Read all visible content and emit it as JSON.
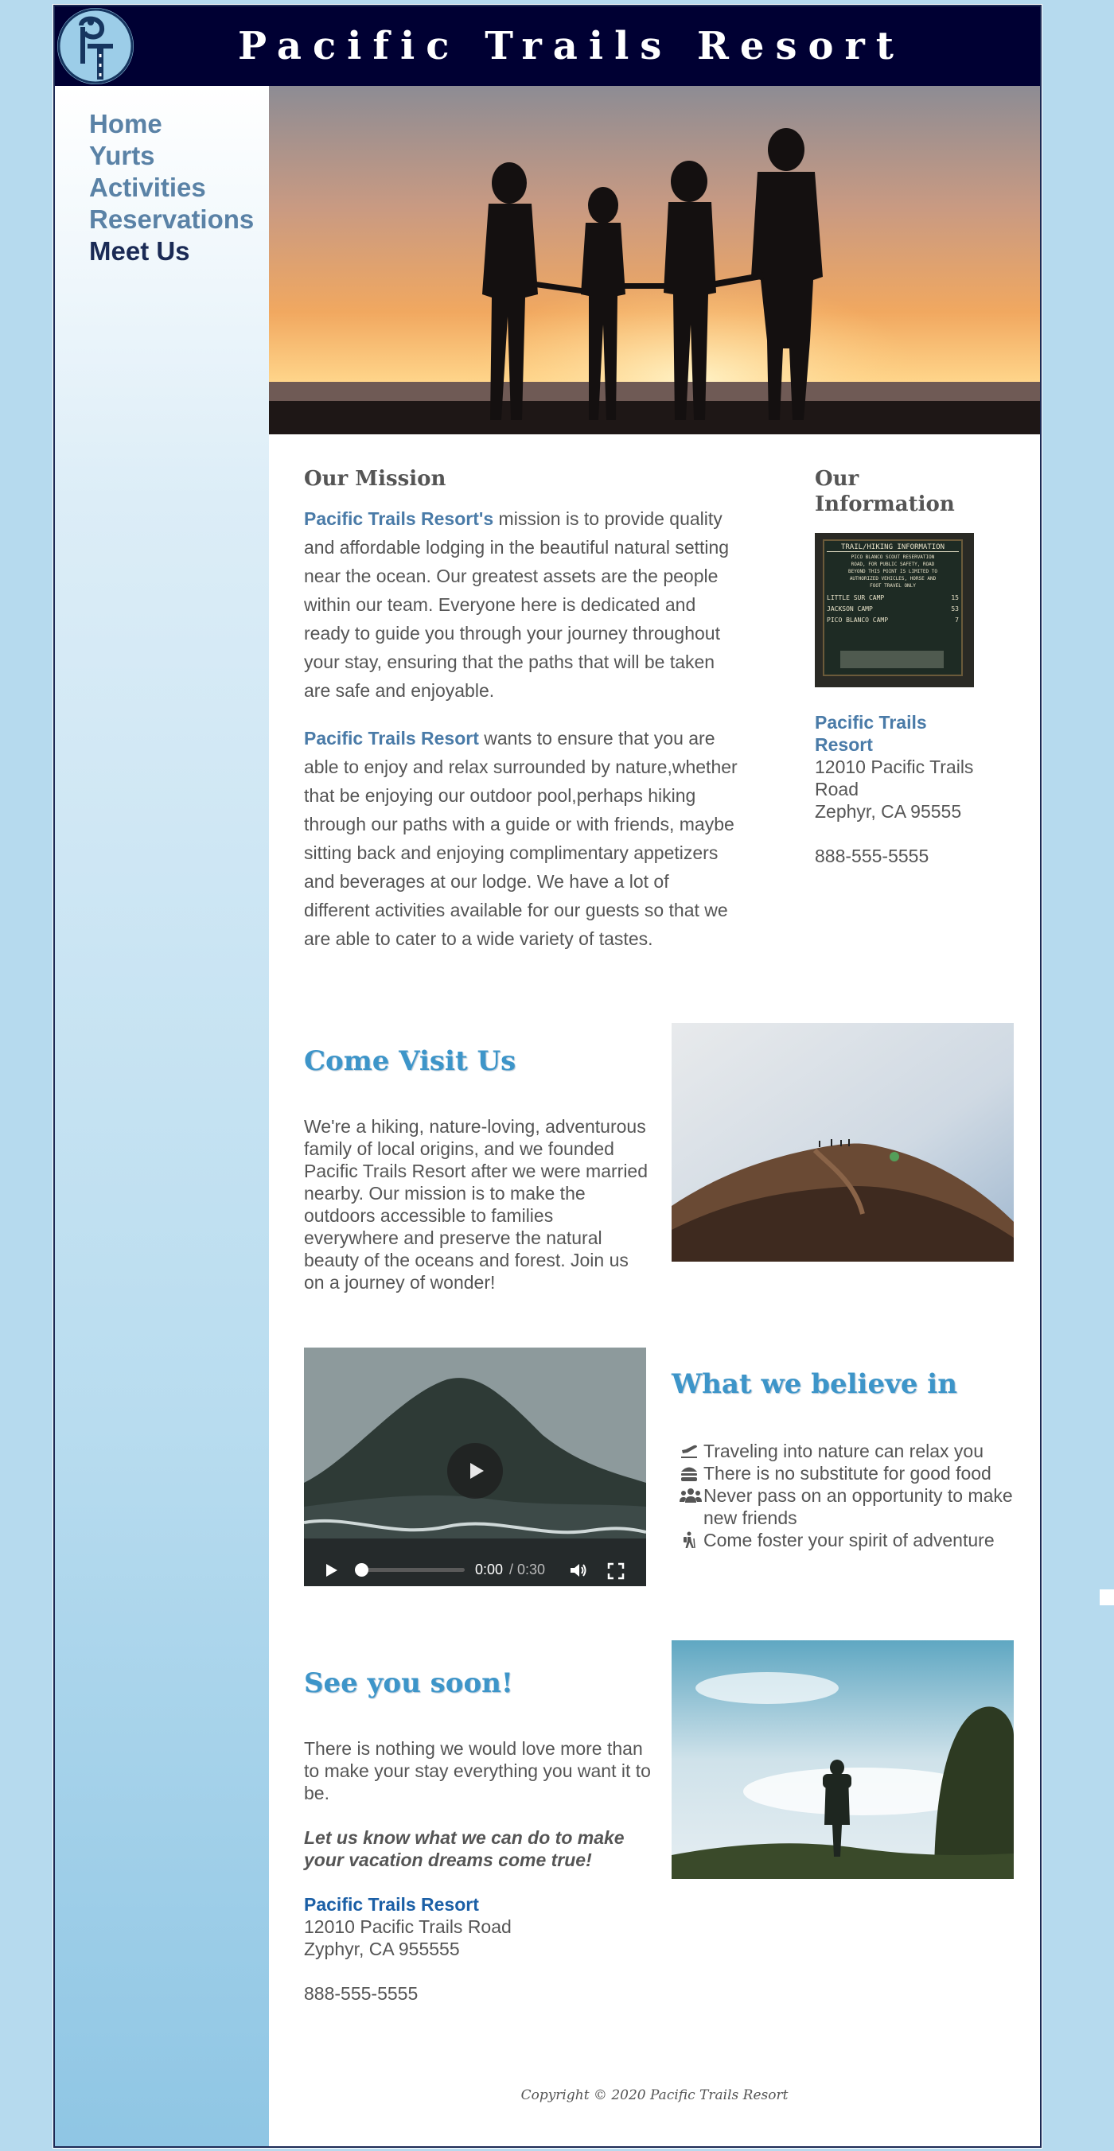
{
  "header": {
    "title": "Pacific Trails Resort",
    "logo_icon": "pt-logo-icon"
  },
  "nav": [
    {
      "label": "Home"
    },
    {
      "label": "Yurts"
    },
    {
      "label": "Activities"
    },
    {
      "label": "Reservations"
    },
    {
      "label": "Meet Us"
    }
  ],
  "mission": {
    "heading": "Our Mission",
    "p1_brand": "Pacific Trails Resort's",
    "p1_text": " mission is to provide quality and affordable lodging in the beautiful natural setting near the ocean. Our greatest assets are the people within our team. Everyone here is dedicated and ready to guide you through your journey throughout your stay, ensuring that the paths that will be taken are safe and enjoyable.",
    "p2_brand": "Pacific Trails Resort",
    "p2_text": " wants to ensure that you are able to enjoy and relax surrounded by nature,whether that be enjoying our outdoor pool,perhaps hiking through our paths with a guide or with friends, maybe sitting back and enjoying complimentary appetizers and beverages at our lodge. We have a lot of different activities available for our guests so that we are able to cater to a wide variety of tastes."
  },
  "info": {
    "heading": "Our Information",
    "sign_title": "TRAIL/HIKING INFORMATION",
    "sign_lines": [
      "PICO BLANCO SCOUT RESERVATION",
      "ROAD, FOR PUBLIC SAFETY, ROAD",
      "BEYOND THIS POINT IS LIMITED TO",
      "AUTHORIZED VEHICLES, HORSE AND",
      "FOOT TRAVEL ONLY"
    ],
    "sign_rows": [
      {
        "name": "LITTLE SUR CAMP",
        "dist": "15"
      },
      {
        "name": "JACKSON CAMP",
        "dist": "53"
      },
      {
        "name": "PICO BLANCO CAMP",
        "dist": "7"
      }
    ],
    "name": "Pacific Trails Resort",
    "street": "12010 Pacific Trails Road",
    "city": "Zephyr, CA 95555",
    "phone": "888-555-5555"
  },
  "visit": {
    "heading": "Come Visit Us",
    "text": "We're a hiking, nature-loving, adventurous family of local origins, and we founded Pacific Trails Resort after we were married nearby. Our mission is to make the outdoors accessible to families everywhere and preserve the natural beauty of the oceans and forest. Join us on a journey of wonder!"
  },
  "video": {
    "time": "0:00",
    "duration": "/ 0:30",
    "progress": 0
  },
  "beliefs": {
    "heading": "What we believe in",
    "items": [
      {
        "icon": "plane-icon",
        "text": "Traveling into nature can relax you"
      },
      {
        "icon": "burger-icon",
        "text": "There is no substitute for good food"
      },
      {
        "icon": "users-icon",
        "text": "Never pass on an opportunity to make new friends"
      },
      {
        "icon": "hiking-icon",
        "text": "Come foster your spirit of adventure"
      }
    ]
  },
  "soon": {
    "heading": "See you soon!",
    "text": "There is nothing we would love more than to make your stay everything you want it to be.",
    "emphasis": "Let us know what we can do to make your vacation dreams come true!",
    "name": "Pacific Trails Resort",
    "street": "12010 Pacific Trails Road",
    "city": "Zyphyr, CA 955555",
    "phone": "888-555-5555"
  },
  "footer": {
    "copyright": "Copyright © 2020 Pacific Trails Resort"
  },
  "colors": {
    "header_bg": "#000033",
    "nav_link": "#5a82a6",
    "nav_current": "#1a2a55",
    "accent_heading": "#3d95c9",
    "brand_text": "#4a7ba8"
  }
}
